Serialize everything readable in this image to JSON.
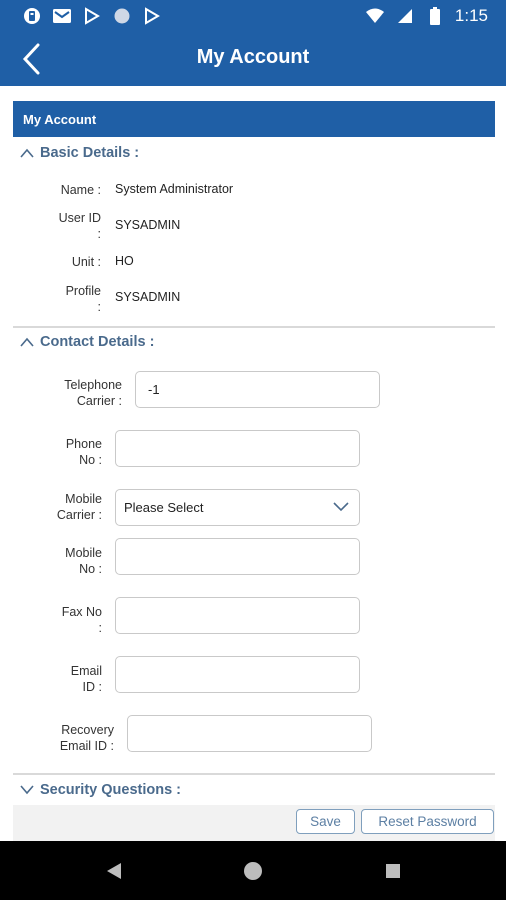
{
  "status_bar": {
    "time": "1:15",
    "left_icons": [
      "notification-icon",
      "gmail-icon",
      "play-store-icon",
      "circle-icon",
      "play-store-icon"
    ],
    "right_icons": [
      "wifi-icon",
      "signal-icon",
      "battery-icon"
    ]
  },
  "app_bar": {
    "title": "My Account",
    "back_icon": "back-arrow-icon"
  },
  "panel": {
    "header": "My Account"
  },
  "basic_details": {
    "title": "Basic Details :",
    "rows": [
      {
        "label": "Name :",
        "value": "System Administrator"
      },
      {
        "label": "User ID\n:",
        "value": "SYSADMIN"
      },
      {
        "label": "Unit :",
        "value": "HO"
      },
      {
        "label": "Profile\n:",
        "value": "SYSADMIN"
      }
    ]
  },
  "contact_details": {
    "title": "Contact Details :",
    "fields": [
      {
        "label": "Telephone\nCarrier :",
        "value": ""
      },
      {
        "label": "Phone\nNo :",
        "value": ""
      },
      {
        "label": "Mobile\nCarrier :",
        "value": "Please Select"
      },
      {
        "label": "Mobile\nNo :",
        "value": ""
      },
      {
        "label": "Fax No\n:",
        "value": ""
      },
      {
        "label": "Email\nID :",
        "value": ""
      },
      {
        "label": "Recovery\nEmail ID :",
        "value": ""
      }
    ],
    "telephone_carrier_value": "-1"
  },
  "security_questions": {
    "title": "Security Questions :"
  },
  "footer": {
    "save_label": "Save",
    "reset_label": "Reset Password"
  },
  "colors": {
    "primary": "#1f5fa6",
    "section_title": "#4a6a8c",
    "button_text": "#5c7fa3"
  }
}
